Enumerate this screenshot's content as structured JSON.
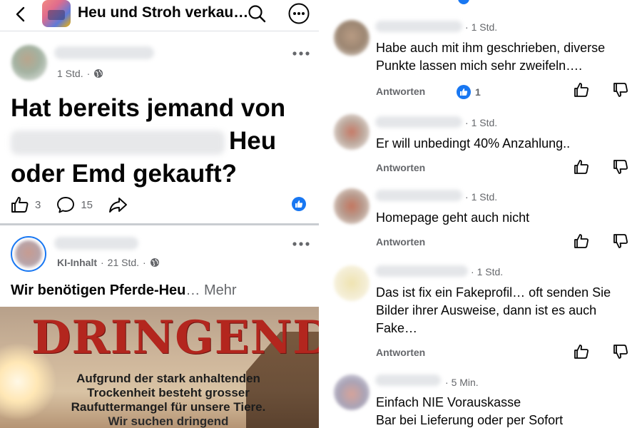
{
  "left": {
    "group_title": "Heu und Stroh verkau…",
    "post1": {
      "time": "1 Std.",
      "headline_line1": "Hat bereits jemand von",
      "headline_line2_end": "Heu",
      "headline_line3": "oder Emd gekauft?",
      "likes": "3",
      "comments": "15"
    },
    "post2": {
      "badge": "KI-Inhalt",
      "time": "21 Std.",
      "text": "Wir benötigen Pferde-Heu",
      "ellipsis": "…",
      "more": "Mehr",
      "image": {
        "headline": "DRINGEND",
        "line1": "Aufgrund der stark anhaltenden",
        "line2": "Trockenheit besteht grosser",
        "line3": "Raufuttermangel für unsere Tiere.",
        "line4": "Wir suchen dringend"
      }
    }
  },
  "comments": [
    {
      "time": "1 Std.",
      "lines": [
        "Habe auch mit ihm geschrieben, diverse",
        "Punkte lassen mich sehr zweifeln…."
      ],
      "reply": "Antworten",
      "reactions": "1"
    },
    {
      "time": "1 Std.",
      "lines": [
        "Er will unbedingt 40% Anzahlung.."
      ],
      "reply": "Antworten"
    },
    {
      "time": "1 Std.",
      "lines": [
        "Homepage geht auch nicht"
      ],
      "reply": "Antworten"
    },
    {
      "time": "1 Std.",
      "lines": [
        "Das ist fix ein Fakeprofil… oft senden Sie",
        "Bilder ihrer Ausweise, dann ist es auch",
        "Fake…"
      ],
      "reply": "Antworten"
    },
    {
      "time": "5 Min.",
      "lines": [
        "Einfach NIE Vorauskasse",
        "Bar bei Lieferung oder per Sofort"
      ]
    }
  ],
  "colors": {
    "accent": "#1877f2",
    "secondary_text": "#65676b",
    "dringend_red": "#b3261e"
  }
}
